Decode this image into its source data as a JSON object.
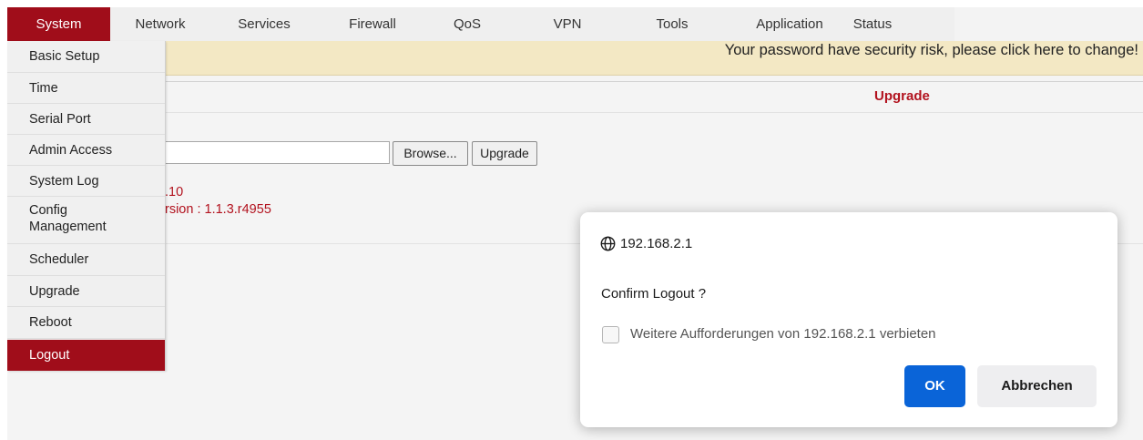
{
  "nav": {
    "items": [
      "System",
      "Network",
      "Services",
      "Firewall",
      "QoS",
      "VPN",
      "Tools",
      "Application",
      "Status"
    ],
    "active": "System"
  },
  "warning": "Your password have security risk, please click here to change!",
  "dropdown": {
    "items": [
      "Basic Setup",
      "Time",
      "Serial Port",
      "Admin Access",
      "System Log",
      "Config Management",
      "Scheduler",
      "Upgrade",
      "Reboot",
      "Logout"
    ],
    "active": "Logout"
  },
  "upgrade": {
    "title": "Upgrade",
    "browse_label": "Browse...",
    "upgrade_label": "Upgrade",
    "version_fragment": ".10",
    "build_fragment": "rsion : 1.1.3.r4955"
  },
  "dialog": {
    "origin": "192.168.2.1",
    "message": "Confirm Logout ?",
    "checkbox_label": "Weitere Aufforderungen von 192.168.2.1 verbieten",
    "ok_label": "OK",
    "cancel_label": "Abbrechen"
  },
  "colors": {
    "accent_red": "#a00d1a",
    "warning_bg": "#f3e8c4",
    "ok_blue": "#0a64d8"
  }
}
